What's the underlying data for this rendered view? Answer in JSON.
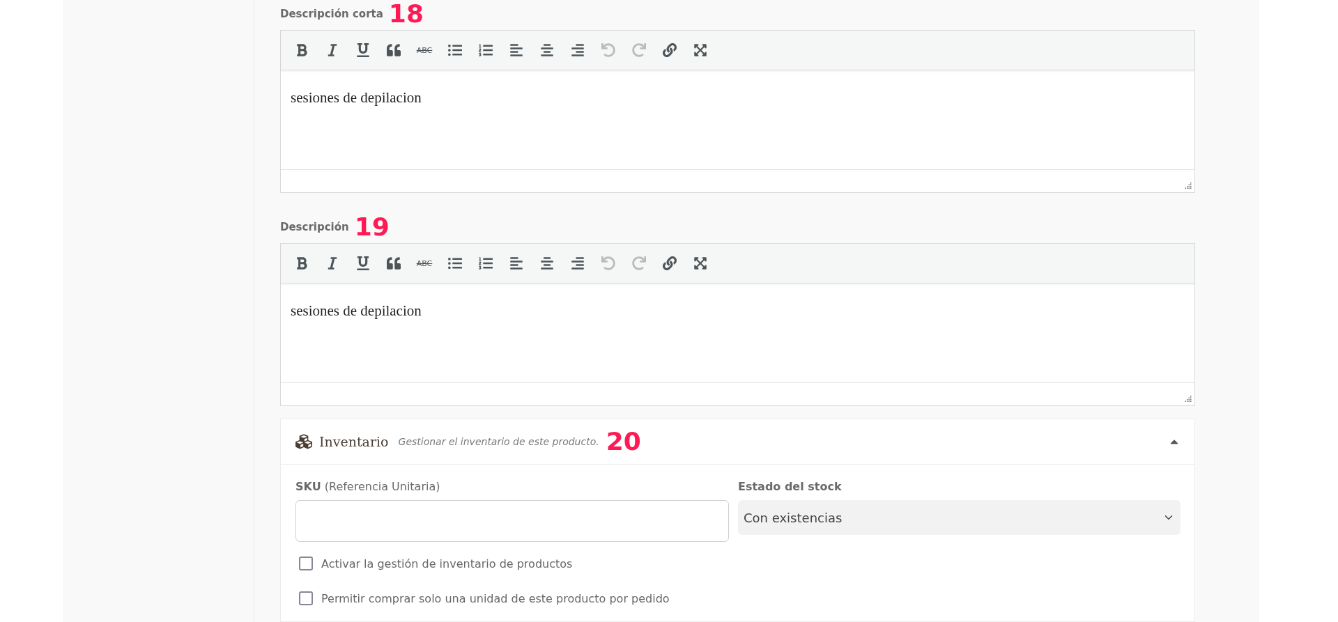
{
  "editors": [
    {
      "label": "Descripción corta",
      "badge": "18",
      "value": "sesiones de depilacion",
      "tools": [
        {
          "kind": "bold",
          "disabled": false
        },
        {
          "kind": "italic",
          "disabled": false
        },
        {
          "kind": "underline",
          "disabled": false
        },
        {
          "kind": "quote",
          "disabled": false
        },
        {
          "kind": "strike",
          "label": "ABC",
          "disabled": false
        },
        {
          "kind": "bullets",
          "disabled": false
        },
        {
          "kind": "numbers",
          "disabled": false
        },
        {
          "kind": "align-left",
          "disabled": false
        },
        {
          "kind": "align-center",
          "disabled": false
        },
        {
          "kind": "align-right",
          "disabled": false
        },
        {
          "kind": "undo",
          "disabled": true
        },
        {
          "kind": "redo",
          "disabled": true
        },
        {
          "kind": "link",
          "disabled": false
        },
        {
          "kind": "fullscreen",
          "disabled": false
        }
      ]
    },
    {
      "label": "Descripción",
      "badge": "19",
      "value": "sesiones de depilacion",
      "tools": [
        {
          "kind": "bold",
          "disabled": false
        },
        {
          "kind": "italic",
          "disabled": false
        },
        {
          "kind": "underline",
          "disabled": false
        },
        {
          "kind": "quote",
          "disabled": false
        },
        {
          "kind": "strike",
          "label": "ABC",
          "disabled": false
        },
        {
          "kind": "bullets",
          "disabled": false
        },
        {
          "kind": "numbers",
          "disabled": false
        },
        {
          "kind": "align-left",
          "disabled": false
        },
        {
          "kind": "align-center",
          "disabled": false
        },
        {
          "kind": "align-right",
          "disabled": false
        },
        {
          "kind": "undo",
          "disabled": true
        },
        {
          "kind": "redo",
          "disabled": true
        },
        {
          "kind": "link",
          "disabled": false
        },
        {
          "kind": "fullscreen",
          "disabled": false
        }
      ]
    }
  ],
  "inventory": {
    "title": "Inventario",
    "subtitle": "Gestionar el inventario de este producto.",
    "badge": "20",
    "expanded": true,
    "sku": {
      "label": "SKU",
      "hint": "(Referencia Unitaria)"
    },
    "stock_status": {
      "label": "Estado del stock",
      "value": "Con existencias"
    },
    "options": [
      {
        "label": "Activar la gestión de inventario de productos",
        "checked": false
      },
      {
        "label": "Permitir comprar solo una unidad de este producto por pedido",
        "checked": false
      }
    ]
  }
}
